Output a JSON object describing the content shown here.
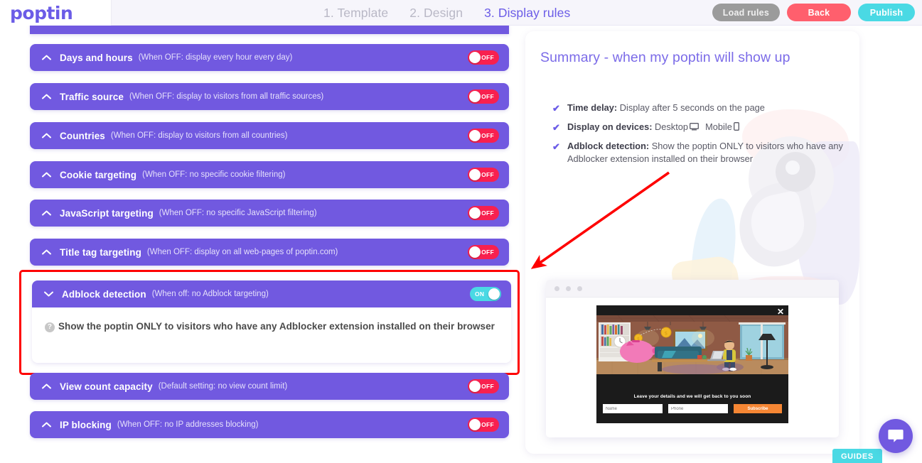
{
  "app": {
    "logo": "poptin"
  },
  "steps": [
    {
      "label": "1. Template",
      "active": false
    },
    {
      "label": "2. Design",
      "active": false
    },
    {
      "label": "3. Display rules",
      "active": true
    }
  ],
  "topbar_buttons": {
    "load_rules": "Load rules",
    "back": "Back",
    "publish": "Publish"
  },
  "rules": [
    {
      "title": "Days and hours",
      "sub": "(When OFF: display every hour every day)",
      "state": "OFF"
    },
    {
      "title": "Traffic source",
      "sub": "(When OFF: display to visitors from all traffic sources)",
      "state": "OFF"
    },
    {
      "title": "Countries",
      "sub": "(When OFF: display to visitors from all countries)",
      "state": "OFF"
    },
    {
      "title": "Cookie targeting",
      "sub": "(When OFF: no specific cookie filtering)",
      "state": "OFF"
    },
    {
      "title": "JavaScript targeting",
      "sub": "(When OFF: no specific JavaScript filtering)",
      "state": "OFF"
    },
    {
      "title": "Title tag targeting",
      "sub": "(When OFF: display on all web-pages of poptin.com)",
      "state": "OFF"
    }
  ],
  "adblock_rule": {
    "title": "Adblock detection",
    "sub": "(When off: no Adblock targeting)",
    "state": "ON",
    "help_icon": "?",
    "body_text": "Show the poptin ONLY to visitors who have any Adblocker extension installed on their browser"
  },
  "rules_after": [
    {
      "title": "View count capacity",
      "sub": "(Default setting: no view count limit)",
      "state": "OFF"
    },
    {
      "title": "IP blocking",
      "sub": "(When OFF: no IP addresses blocking)",
      "state": "OFF"
    }
  ],
  "summary": {
    "title": "Summary - when my poptin will show up",
    "items": [
      {
        "label": "Time delay:",
        "value": "Display after 5 seconds on the page"
      },
      {
        "label": "Display on devices:",
        "value": "Desktop",
        "value2": "Mobile"
      },
      {
        "label": "Adblock detection:",
        "value": "Show the poptin ONLY to visitors who have any Adblocker extension installed on their browser"
      }
    ]
  },
  "preview": {
    "popup_headline": "Leave your details and we will get back to you soon",
    "name_placeholder": "Name",
    "phone_placeholder": "Phone",
    "subscribe_label": "Subscribe",
    "close_label": "✕"
  },
  "footer": {
    "guides": "GUIDES"
  },
  "colors": {
    "purple": "#7159e0",
    "accent_purple": "#6b5ce7",
    "toggle_off": "#f8204f",
    "toggle_on": "#4ad9e4",
    "back_red": "#ff5f6d",
    "highlight_red": "#fe0000",
    "orange": "#f58634"
  }
}
